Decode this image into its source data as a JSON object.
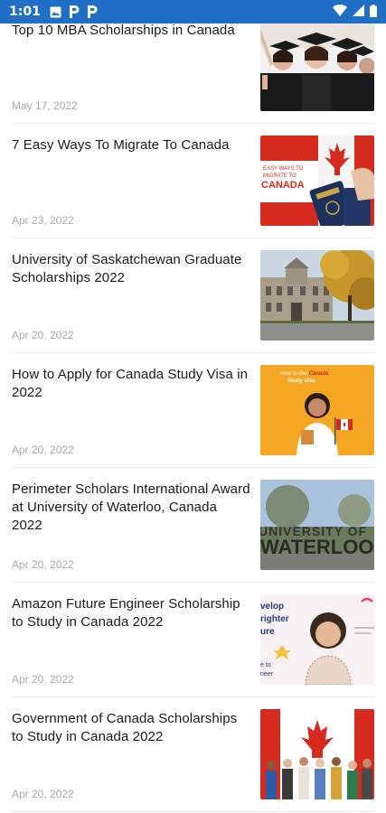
{
  "status_bar": {
    "time": "1:01",
    "notification_icons": [
      "image-icon",
      "parking-icon",
      "parking-icon"
    ],
    "system_icons": [
      "wifi-icon",
      "signal-icon",
      "battery-icon"
    ]
  },
  "articles": [
    {
      "title": "Top 10 MBA Scholarships in Canada",
      "date": "May 17, 2022",
      "thumbnail": "graduates-photo"
    },
    {
      "title": "7 Easy Ways To Migrate To Canada",
      "date": "Apr 23, 2022",
      "thumbnail": "canada-passport-image",
      "thumbnail_text": [
        "EASY WAYS TO",
        "MIGRATE TO",
        "CANADA"
      ]
    },
    {
      "title": "University of Saskatchewan Graduate Scholarships 2022",
      "date": "Apr 20, 2022",
      "thumbnail": "university-building-photo"
    },
    {
      "title": "How to Apply for Canada Study Visa in 2022",
      "date": "Apr 20, 2022",
      "thumbnail": "study-visa-illustration",
      "thumbnail_text": [
        "How to Get ",
        "Canada",
        "Study Visa"
      ]
    },
    {
      "title": "Perimeter Scholars International Award at University of Waterloo, Canada 2022",
      "date": "Apr 20, 2022",
      "thumbnail": "waterloo-sign-photo",
      "thumbnail_text": [
        "UNIVERSITY OF",
        "WATERLOO"
      ]
    },
    {
      "title": "Amazon Future Engineer Scholarship to Study in Canada 2022",
      "date": "Apr 20, 2022",
      "thumbnail": "future-engineer-image",
      "thumbnail_text": [
        "velop",
        "righter",
        "ure",
        "e to",
        "neer"
      ]
    },
    {
      "title": "Government of Canada Scholarships to Study in Canada 2022",
      "date": "Apr 20, 2022",
      "thumbnail": "canada-flag-students-image"
    }
  ],
  "colors": {
    "status_bar": "#1f6fc7",
    "divider": "#ececec",
    "date_text": "#a9a9a9",
    "canada_red": "#d52b1e",
    "visa_orange": "#f5a623"
  }
}
